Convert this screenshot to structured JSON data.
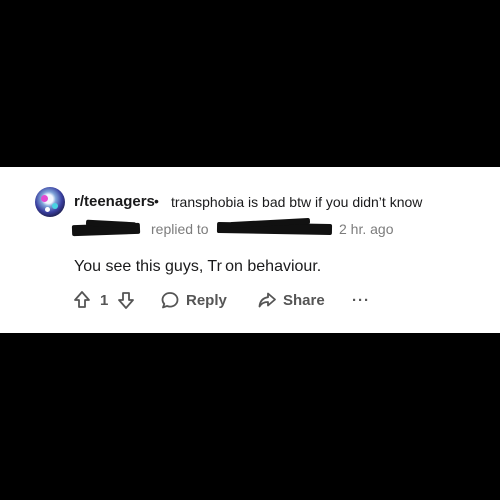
{
  "comment": {
    "subreddit": "r/teenagers",
    "separator": "•",
    "post_title": "transphobia is bad btw if you didn’t know",
    "replied_to_label": "replied to",
    "time_ago": "2 hr. ago",
    "body": "You see this guys, Tr on behaviour.",
    "vote_count": "1"
  },
  "actions": {
    "reply_label": "Reply",
    "share_label": "Share",
    "more_label": "···"
  },
  "icons": {
    "upvote": "arrow-up-outline-icon",
    "downvote": "arrow-down-outline-icon",
    "reply": "speech-bubble-icon",
    "share": "share-arrow-icon",
    "more": "ellipsis-icon"
  },
  "colors": {
    "background": "#000000",
    "card": "#ffffff",
    "text": "#1a1a1b",
    "meta": "#7c7c7c",
    "action": "#555555"
  }
}
